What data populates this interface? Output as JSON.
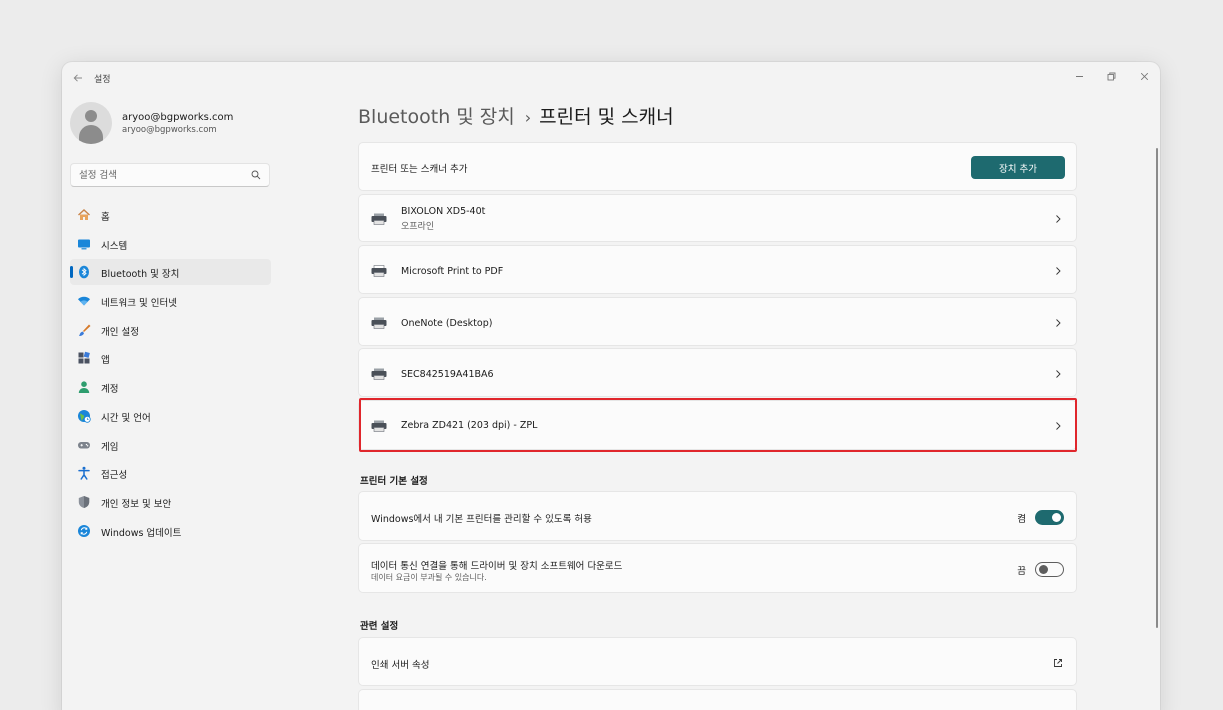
{
  "titlebar": {
    "app_title": "설정",
    "back_icon": "back-arrow-icon",
    "minimize_glyph": "—",
    "maximize_glyph": "❐",
    "close_glyph": "✕"
  },
  "profile": {
    "name": "aryoo@bgpworks.com",
    "email": "aryoo@bgpworks.com"
  },
  "search": {
    "placeholder": "설정 검색",
    "value": ""
  },
  "sidebar": {
    "items": [
      {
        "label": "홈",
        "icon": "home-icon",
        "active": false
      },
      {
        "label": "시스템",
        "icon": "system-icon",
        "active": false
      },
      {
        "label": "Bluetooth 및 장치",
        "icon": "bluetooth-icon",
        "active": true
      },
      {
        "label": "네트워크 및 인터넷",
        "icon": "wifi-icon",
        "active": false
      },
      {
        "label": "개인 설정",
        "icon": "brush-icon",
        "active": false
      },
      {
        "label": "앱",
        "icon": "apps-icon",
        "active": false
      },
      {
        "label": "계정",
        "icon": "account-icon",
        "active": false
      },
      {
        "label": "시간 및 언어",
        "icon": "globe-clock-icon",
        "active": false
      },
      {
        "label": "게임",
        "icon": "gamepad-icon",
        "active": false
      },
      {
        "label": "접근성",
        "icon": "accessibility-icon",
        "active": false
      },
      {
        "label": "개인 정보 및 보안",
        "icon": "shield-icon",
        "active": false
      },
      {
        "label": "Windows 업데이트",
        "icon": "update-icon",
        "active": false
      }
    ]
  },
  "breadcrumb": {
    "parent": "Bluetooth 및 장치",
    "separator": "›",
    "current": "프린터 및 스캐너"
  },
  "add_device": {
    "label": "프린터 또는 스캐너 추가",
    "button_label": "장치 추가"
  },
  "printers": [
    {
      "name": "BIXOLON XD5-40t",
      "status": "오프라인",
      "icon": "printer-icon"
    },
    {
      "name": "Microsoft Print to PDF",
      "status": "",
      "icon": "printer-pdf-icon"
    },
    {
      "name": "OneNote (Desktop)",
      "status": "",
      "icon": "printer-icon"
    },
    {
      "name": "SEC842519A41BA6",
      "status": "",
      "icon": "printer-icon"
    },
    {
      "name": "Zebra ZD421 (203 dpi) - ZPL",
      "status": "",
      "icon": "printer-icon",
      "highlighted": true
    }
  ],
  "printer_prefs": {
    "title": "프린터 기본 설정",
    "items": [
      {
        "label": "Windows에서 내 기본 프린터를 관리할 수 있도록 허용",
        "sub": "",
        "state_text": "켬",
        "on": true
      },
      {
        "label": "데이터 통신 연결을 통해 드라이버 및 장치 소프트웨어 다운로드",
        "sub": "데이터 요금이 부과될 수 있습니다.",
        "state_text": "끔",
        "on": false
      }
    ]
  },
  "related": {
    "title": "관련 설정",
    "items": [
      {
        "label": "인쇄 서버 속성",
        "icon": "external-link-icon"
      }
    ]
  },
  "colors": {
    "accent": "#1e6a6f",
    "nav_indicator": "#0067c0",
    "highlight_border": "#e0262c"
  }
}
